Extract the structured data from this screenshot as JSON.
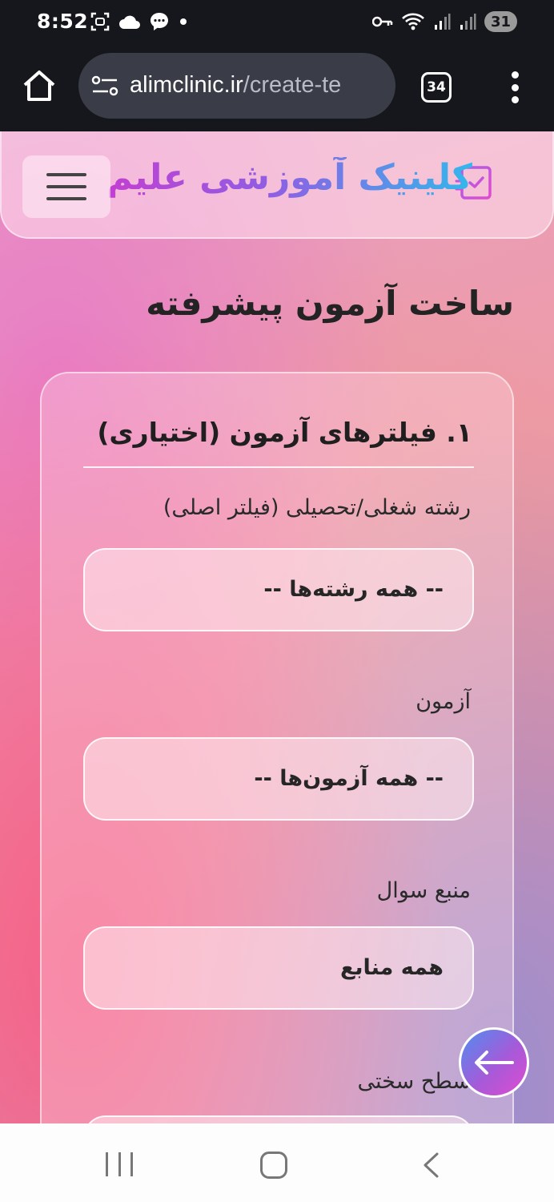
{
  "status_bar": {
    "time": "8:52",
    "battery": "31",
    "icons": [
      "screenshot-icon",
      "cloud-icon",
      "chat-icon",
      "dot-icon",
      "key-icon",
      "wifi-icon",
      "signal-icon",
      "signal-icon"
    ]
  },
  "browser": {
    "url_domain": "alimclinic.ir",
    "url_path": "/create-te",
    "tab_count": "34"
  },
  "header": {
    "brand_name": "کلینیک آموزشی علیم"
  },
  "page": {
    "title": "ساخت آزمون پیشرفته"
  },
  "card": {
    "title": "۱. فیلترهای آزمون (اختیاری)",
    "fields": [
      {
        "label": "رشته شغلی/تحصیلی (فیلتر اصلی)",
        "value": "-- همه رشته‌ها --"
      },
      {
        "label": "آزمون",
        "value": "-- همه آزمون‌ها --"
      },
      {
        "label": "منبع سوال",
        "value": "همه منابع"
      },
      {
        "label": "سطح سختی",
        "value": ""
      }
    ]
  },
  "colors": {
    "brand_gradient_start": "#c33fd1",
    "brand_gradient_end": "#33b7ec",
    "browser_bg": "#15171c"
  }
}
